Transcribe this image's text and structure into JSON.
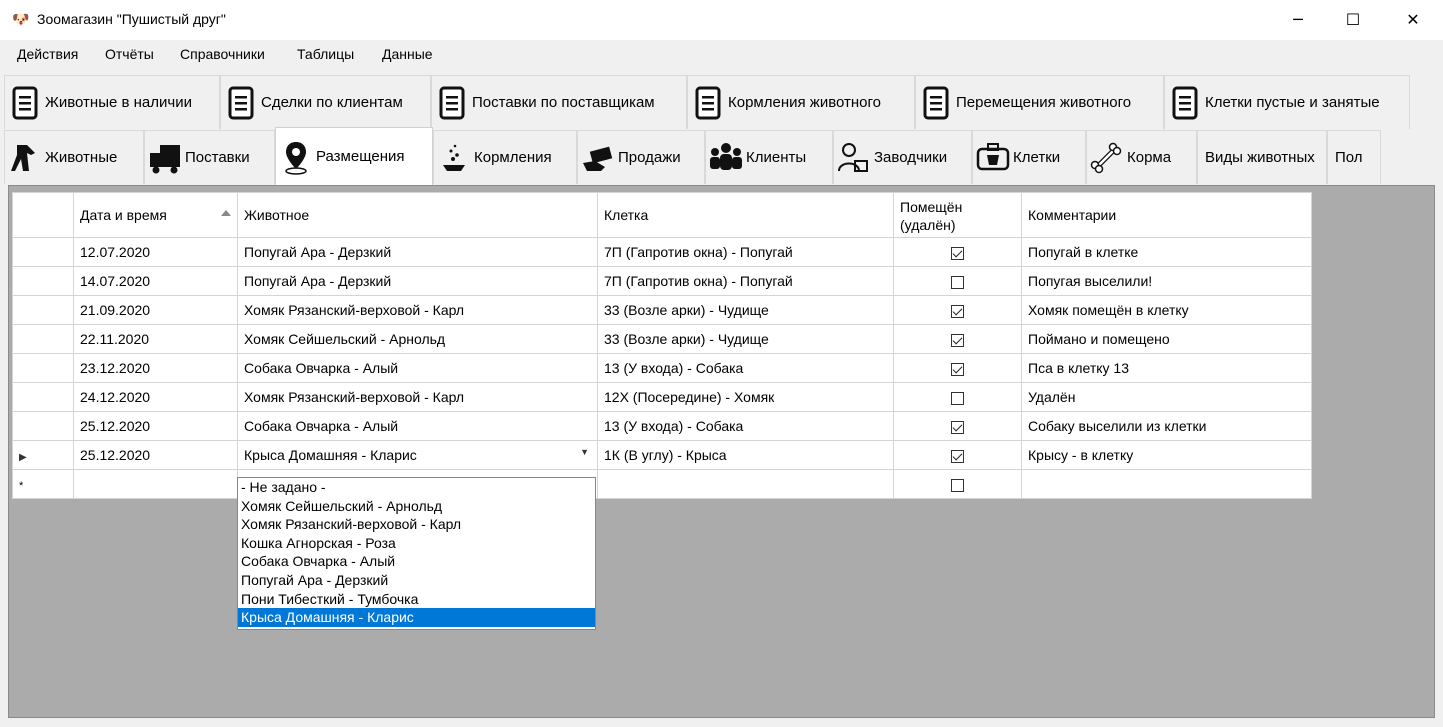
{
  "window": {
    "title": "Зоомагазин \"Пушистый друг\"",
    "minimize": "─",
    "maximize": "☐",
    "close": "✕"
  },
  "menu": [
    "Действия",
    "Отчёты",
    "Справочники",
    "Таблицы",
    "Данные"
  ],
  "report_tabs": [
    {
      "label": "Животные в наличии",
      "icon": "document-icon"
    },
    {
      "label": "Сделки по клиентам",
      "icon": "document-icon"
    },
    {
      "label": "Поставки по поставщикам",
      "icon": "document-icon"
    },
    {
      "label": "Кормления животного",
      "icon": "document-icon"
    },
    {
      "label": "Перемещения животного",
      "icon": "document-icon"
    },
    {
      "label": "Клетки пустые и занятые",
      "icon": "document-icon"
    }
  ],
  "table_tabs": [
    {
      "label": "Животные",
      "icon": "dog-icon"
    },
    {
      "label": "Поставки",
      "icon": "truck-icon"
    },
    {
      "label": "Размещения",
      "icon": "map-pin-icon",
      "active": true
    },
    {
      "label": "Кормления",
      "icon": "feed-icon"
    },
    {
      "label": "Продажи",
      "icon": "money-icon"
    },
    {
      "label": "Клиенты",
      "icon": "people-icon"
    },
    {
      "label": "Заводчики",
      "icon": "breeder-icon"
    },
    {
      "label": "Клетки",
      "icon": "cage-icon"
    },
    {
      "label": "Корма",
      "icon": "bone-icon"
    },
    {
      "label": "Виды животных",
      "icon": ""
    },
    {
      "label": "Пол",
      "icon": ""
    }
  ],
  "grid": {
    "columns": [
      "Дата и время",
      "Животное",
      "Клетка",
      "Помещён (удалён)",
      "Комментарии"
    ],
    "rows": [
      {
        "date": "12.07.2020",
        "animal": "Попугай Ара - Дерзкий",
        "cage": "7П (Гапротив окна) - Попугай",
        "placed": true,
        "comment": " Попугай в клетке"
      },
      {
        "date": "14.07.2020",
        "animal": "Попугай Ара - Дерзкий",
        "cage": "7П (Гапротив окна) - Попугай",
        "placed": false,
        "comment": "Попугая выселили!"
      },
      {
        "date": "21.09.2020",
        "animal": "Хомяк Рязанский-верховой - Карл",
        "cage": "33 (Возле арки) - Чудище",
        "placed": true,
        "comment": "Хомяк помещён в клетку"
      },
      {
        "date": "22.11.2020",
        "animal": "Хомяк Сейшельский - Арнольд",
        "cage": "33 (Возле арки) - Чудище",
        "placed": true,
        "comment": "Поймано и помещено"
      },
      {
        "date": "23.12.2020",
        "animal": "Собака Овчарка - Алый",
        "cage": "13 (У входа) - Собака",
        "placed": true,
        "comment": "Пса в клетку 13"
      },
      {
        "date": "24.12.2020",
        "animal": "Хомяк Рязанский-верховой - Карл",
        "cage": "12Х (Посередине) - Хомяк",
        "placed": false,
        "comment": "Удалён"
      },
      {
        "date": "25.12.2020",
        "animal": "Собака Овчарка - Алый",
        "cage": "13 (У входа) - Собака",
        "placed": true,
        "comment": "Собаку выселили из клетки"
      },
      {
        "date": "25.12.2020",
        "animal": "Крыса Домашняя - Кларис",
        "cage": "1К (В углу) - Крыса",
        "placed": true,
        "comment": "Крысу - в клетку",
        "current": true
      }
    ],
    "new_row_marker": "*",
    "current_row_marker": "▶"
  },
  "dropdown": {
    "options": [
      "- Не задано  -",
      "Хомяк Сейшельский - Арнольд",
      "Хомяк Рязанский-верховой - Карл",
      "Кошка Агнорская - Роза",
      "Собака Овчарка - Алый",
      "Попугай Ара - Дерзкий",
      "Пони Тибесткий - Тумбочка",
      "Крыса Домашняя - Кларис"
    ],
    "selected": "Крыса Домашняя - Кларис"
  },
  "colors": {
    "selection": "#0078d7",
    "grid_bg": "#ababab"
  }
}
